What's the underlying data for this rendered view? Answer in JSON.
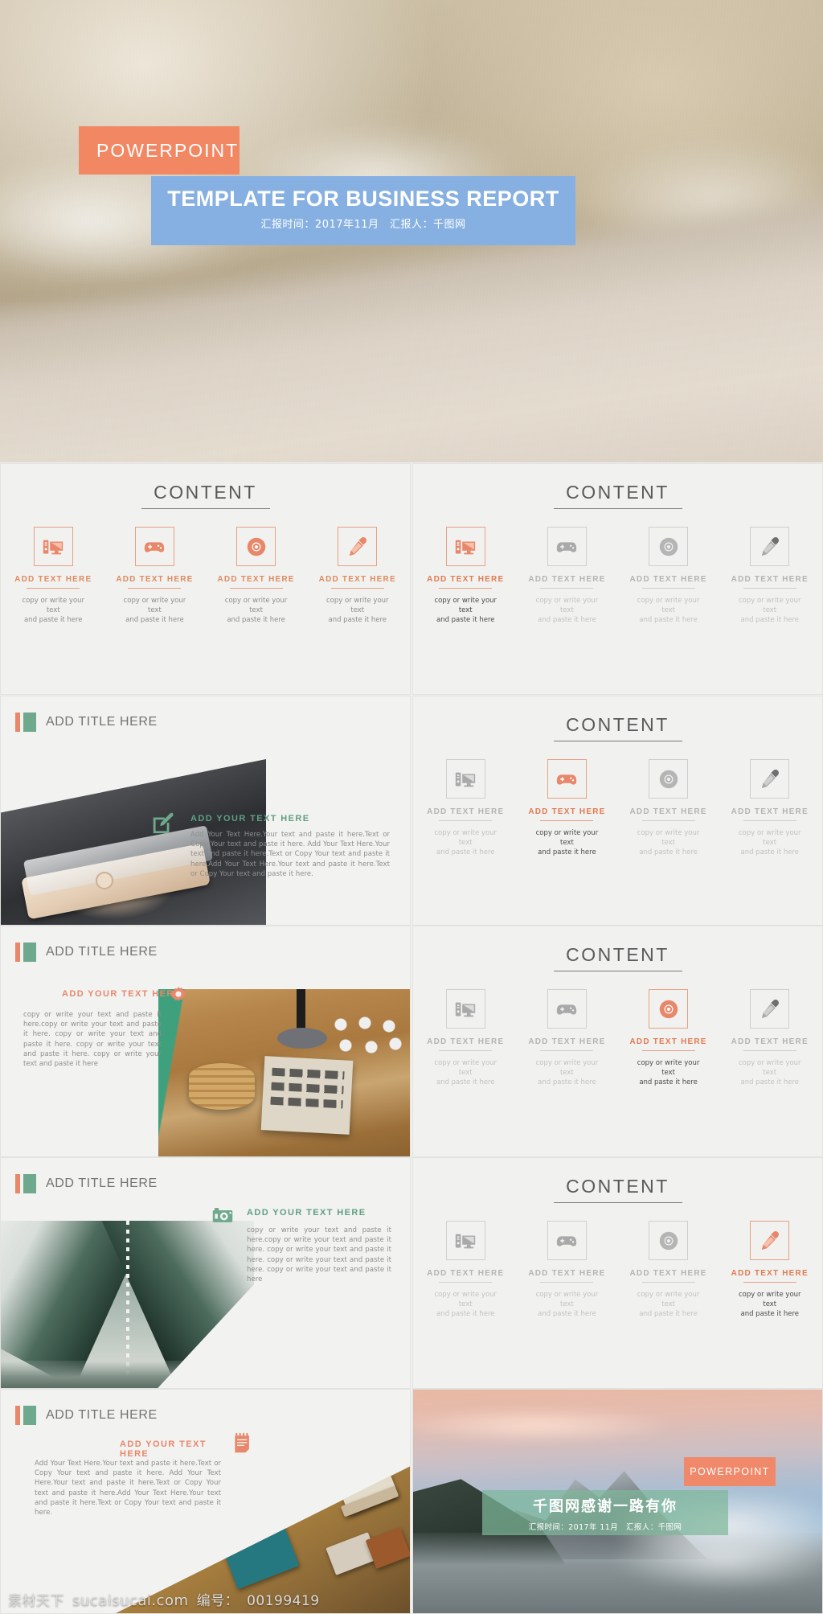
{
  "hero": {
    "badge": "POWERPOINT",
    "title": "TEMPLATE FOR BUSINESS REPORT",
    "subtitle": "汇报时间：2017年11月　汇报人：千图网"
  },
  "content_slide": {
    "heading": "CONTENT",
    "items": [
      {
        "icon": "desktop-computer-icon",
        "label": "ADD TEXT HERE",
        "desc_line1": "copy or write your text",
        "desc_line2": "and paste it here"
      },
      {
        "icon": "gamepad-icon",
        "label": "ADD TEXT HERE",
        "desc_line1": "copy or write your text",
        "desc_line2": "and paste it here"
      },
      {
        "icon": "compact-disc-icon",
        "label": "ADD TEXT HERE",
        "desc_line1": "copy or write your text",
        "desc_line2": "and paste it here"
      },
      {
        "icon": "eyedropper-icon",
        "label": "ADD TEXT HERE",
        "desc_line1": "copy or write your text",
        "desc_line2": "and paste it here"
      }
    ]
  },
  "slides": {
    "content_1": {
      "highlight": "all"
    },
    "content_2": {
      "highlight": 0
    },
    "content_3": {
      "highlight": 1
    },
    "content_4": {
      "highlight": 2
    },
    "content_5": {
      "highlight": 3
    },
    "phone": {
      "title": "ADD TITLE HERE",
      "body_head": "ADD YOUR TEXT HERE",
      "icon": "pencil-edit-icon",
      "body": "Add Your Text Here.Your text and paste it here.Text or Copy Your text and paste it here. Add Your Text Here.Your text and paste it here.Text or Copy Your text and paste it here.Add Your Text Here.Your text and paste it here.Text or Copy Your text and paste it here."
    },
    "wood": {
      "title": "ADD TITLE HERE",
      "body_head": "ADD YOUR TEXT HERE",
      "icon": "gear-icon",
      "body": "copy or write your text and paste it here.copy or write your text and paste it here. copy or write your text and paste it here. copy or write your text and paste it here. copy or write your text and paste it here"
    },
    "bridge": {
      "title": "ADD TITLE HERE",
      "body_head": "ADD YOUR TEXT HERE",
      "icon": "camera-icon",
      "body": "copy or write your text and paste it here.copy or write your text and paste it here. copy or write your text and paste it here. copy or write your text and paste it here. copy or write your text and paste it here"
    },
    "stationery": {
      "title": "ADD TITLE HERE",
      "body_head": "ADD YOUR TEXT HERE",
      "icon": "notepad-icon",
      "body": "Add Your Text Here.Your text and paste it here.Text or Copy Your text and paste it here. Add Your Text Here.Your text and paste it here.Text or Copy Your text and paste it here.Add Your Text Here.Your text and paste it here.Text or Copy Your text and paste it here."
    },
    "thanks": {
      "badge": "POWERPOINT",
      "title": "千图网感谢一路有你",
      "subtitle": "汇报时间：2017年 11月　汇报人：千图网"
    }
  },
  "watermark": {
    "brand": "素材天下",
    "site": "sucaisucai.com",
    "id_label": "编号：",
    "id_value": "00199419"
  },
  "colors": {
    "orange": "#f28763",
    "blue": "#87b0e2",
    "green": "#6fa98d",
    "gray_text": "#8e8e8e",
    "slide_bg": "#f1f1f0"
  }
}
